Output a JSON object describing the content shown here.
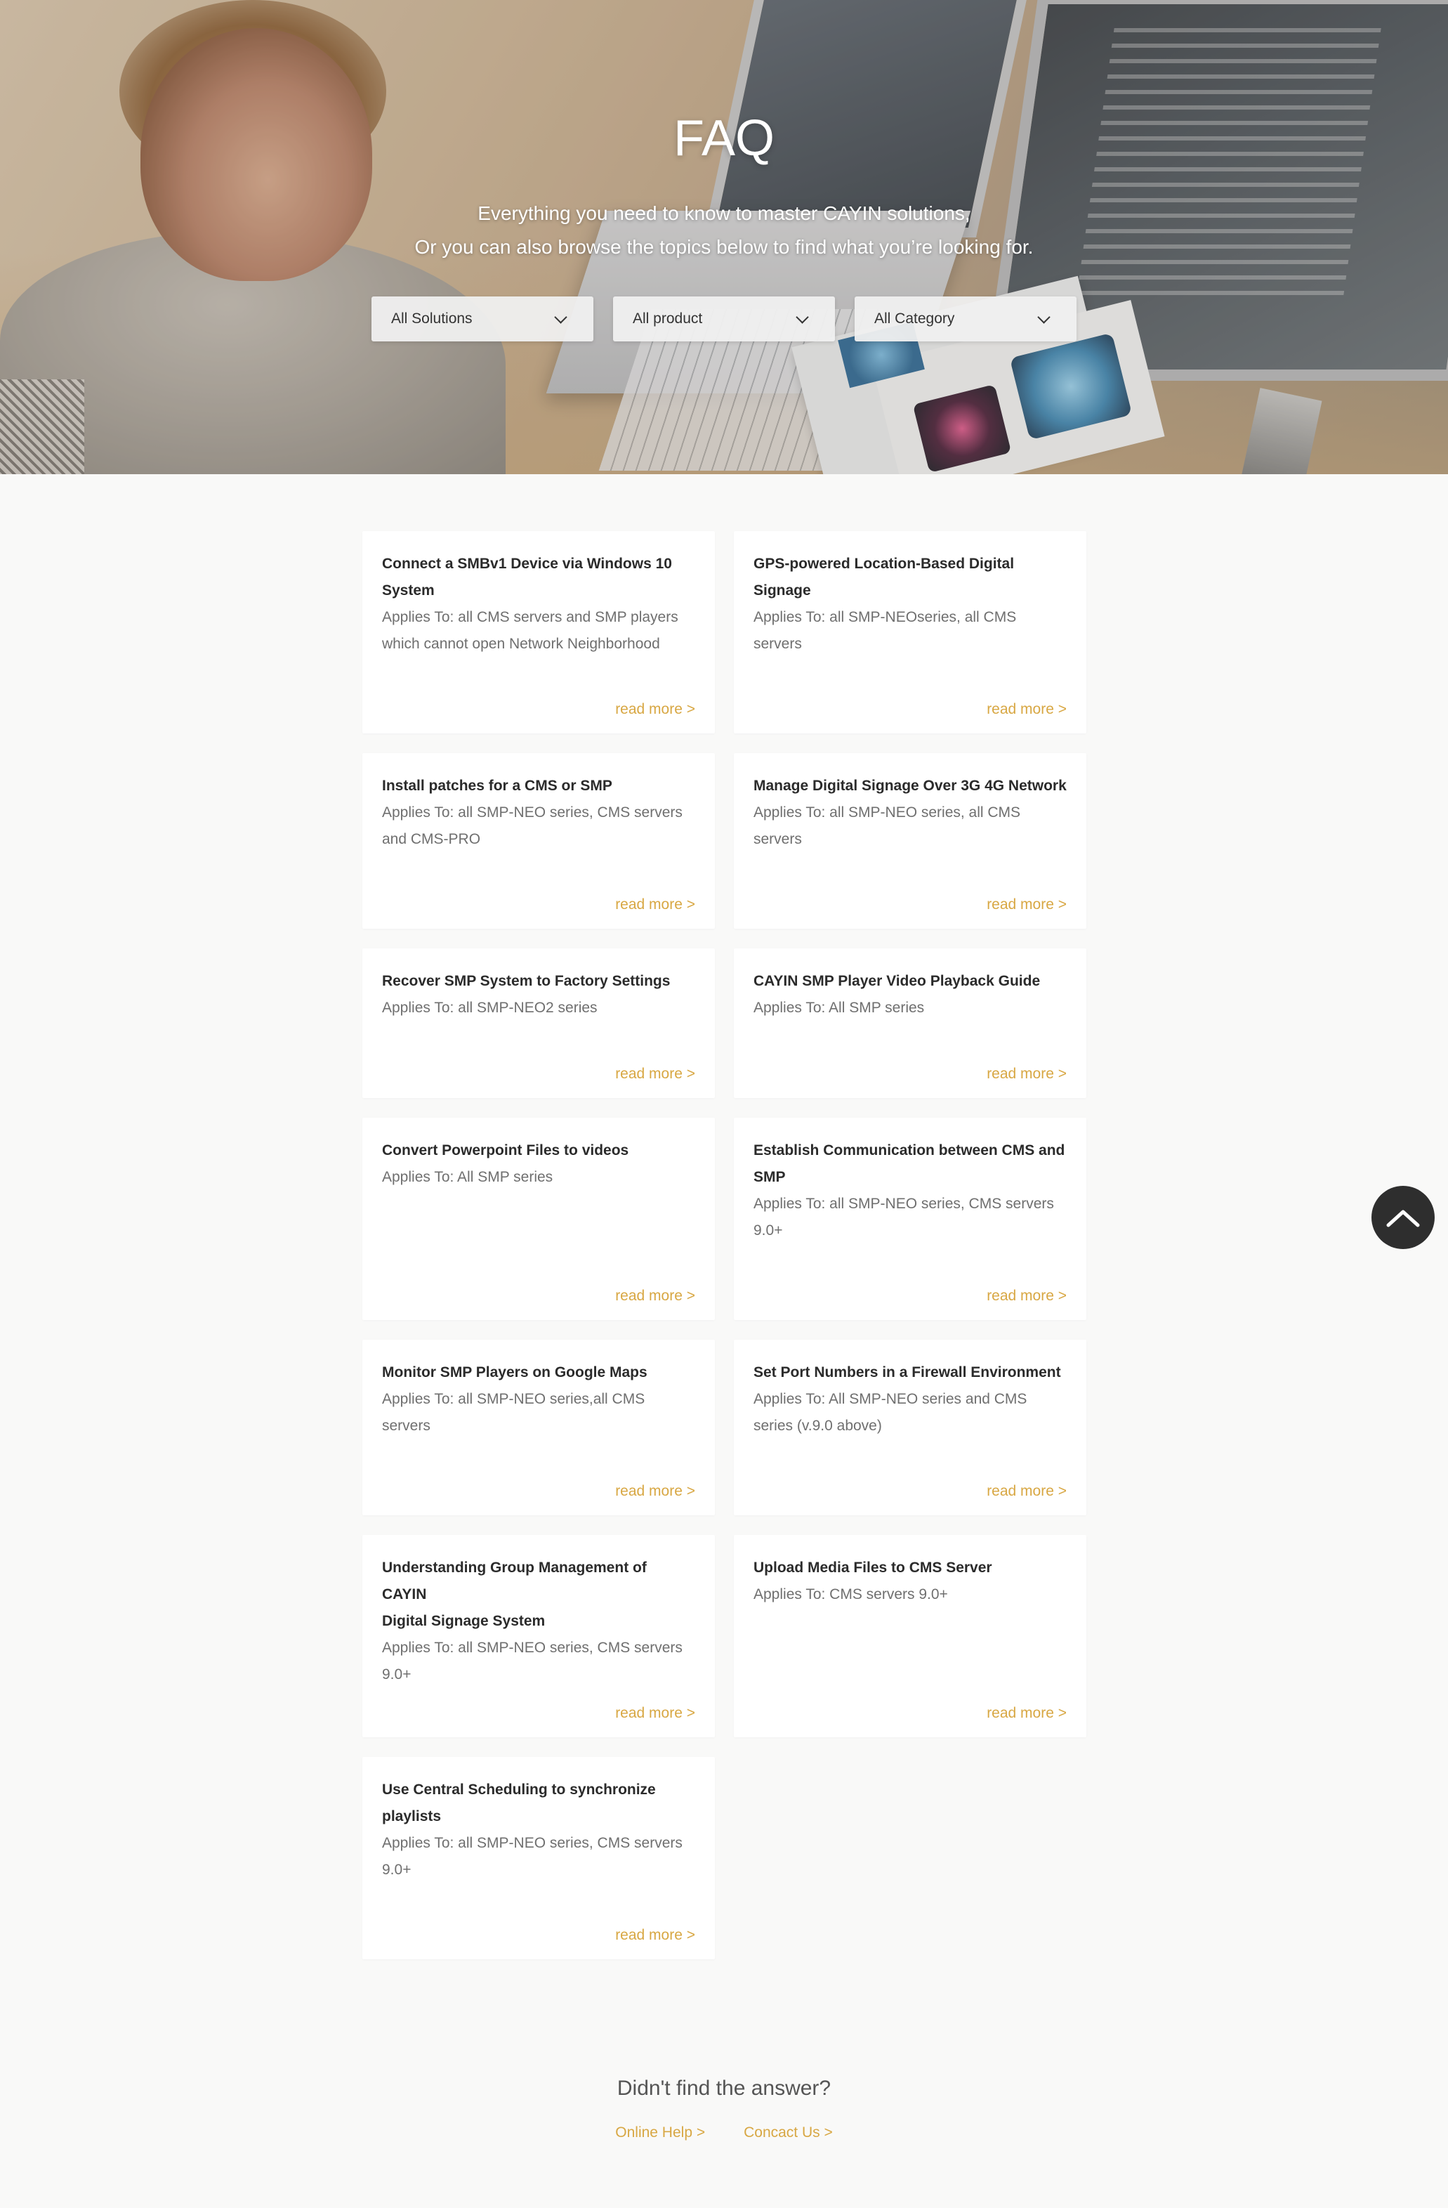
{
  "hero": {
    "title": "FAQ",
    "subtitle_line1": "Everything you need to know to master CAYIN solutions,",
    "subtitle_line2": "Or you can also browse the topics below to find what you’re looking for."
  },
  "filters": [
    {
      "selected": "All Solutions"
    },
    {
      "selected": "All product"
    },
    {
      "selected": "All Category"
    }
  ],
  "faq": [
    {
      "title_l1": "Connect a SMBv1 Device via Windows 10",
      "title_l2": "System",
      "applies_l1": "Applies To: all CMS servers and SMP players",
      "applies_l2": "which cannot open Network Neighborhood",
      "more": "read more >"
    },
    {
      "title_l1": "GPS-powered Location-Based Digital",
      "title_l2": "Signage",
      "applies_l1": "Applies To: all SMP-NEOseries, all CMS",
      "applies_l2": "servers",
      "more": "read more >"
    },
    {
      "title_l1": "Install patches for a CMS or SMP",
      "title_l2": "",
      "applies_l1": "Applies To: all SMP-NEO series, CMS servers",
      "applies_l2": "and CMS-PRO",
      "more": "read more >"
    },
    {
      "title_l1": "Manage Digital Signage Over 3G 4G Network",
      "title_l2": "",
      "applies_l1": "Applies To: all SMP-NEO series, all CMS",
      "applies_l2": "servers",
      "more": "read more >"
    },
    {
      "title_l1": "Recover SMP System to Factory Settings",
      "title_l2": "",
      "applies_l1": "Applies To: all SMP-NEO2 series",
      "applies_l2": "",
      "more": "read more >"
    },
    {
      "title_l1": "CAYIN SMP Player Video Playback Guide",
      "title_l2": "",
      "applies_l1": "Applies To: All SMP series",
      "applies_l2": "",
      "more": "read more >"
    },
    {
      "title_l1": "Convert Powerpoint Files to videos",
      "title_l2": "",
      "applies_l1": "Applies To: All SMP series",
      "applies_l2": "",
      "more": "read more >"
    },
    {
      "title_l1": "Establish Communication between CMS and",
      "title_l2": "SMP",
      "applies_l1": "Applies To: all SMP-NEO series, CMS servers",
      "applies_l2": "9.0+",
      "more": "read more >"
    },
    {
      "title_l1": "Monitor SMP Players on Google Maps",
      "title_l2": "",
      "applies_l1": "Applies To: all SMP-NEO series,all CMS",
      "applies_l2": "servers",
      "more": "read more >"
    },
    {
      "title_l1": "Set Port Numbers in a Firewall Environment",
      "title_l2": "",
      "applies_l1": "Applies To: All SMP-NEO series and CMS",
      "applies_l2": "series (v.9.0 above)",
      "more": "read more >"
    },
    {
      "title_l1": "Understanding Group Management of CAYIN",
      "title_l2": "Digital Signage System",
      "applies_l1": "Applies To: all SMP-NEO series, CMS servers",
      "applies_l2": "9.0+",
      "more": "read more >"
    },
    {
      "title_l1": "Upload Media Files to CMS Server",
      "title_l2": "",
      "applies_l1": "Applies To: CMS servers 9.0+",
      "applies_l2": "",
      "more": "read more >"
    },
    {
      "title_l1": "Use Central Scheduling to synchronize",
      "title_l2": "playlists",
      "applies_l1": "Applies To: all SMP-NEO series, CMS servers",
      "applies_l2": "9.0+",
      "more": "read more >"
    }
  ],
  "footer": {
    "question": "Didn't find the answer?",
    "online_help": "Online Help >",
    "contact": "Concact Us >"
  },
  "icons": {
    "filter_dropdown": "chevron-down-icon",
    "back_to_top": "chevron-up-icon"
  },
  "colors": {
    "accent": "#d8a743",
    "page_bg": "#f9f9f8",
    "card_bg": "#ffffff",
    "back_to_top_bg": "#2e2e2e"
  }
}
